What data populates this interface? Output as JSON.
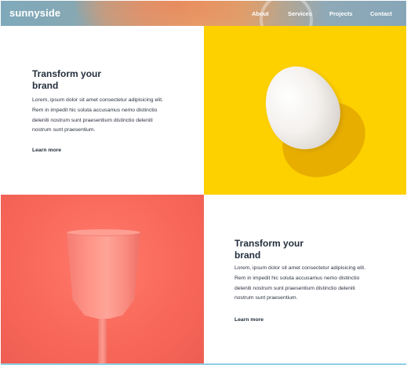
{
  "header": {
    "logo": "sunnyside",
    "nav": [
      {
        "label": "About"
      },
      {
        "label": "Services"
      },
      {
        "label": "Projects"
      },
      {
        "label": "Contact"
      }
    ]
  },
  "features": [
    {
      "heading_line1": "Transform your",
      "heading_line2": "brand",
      "body": "Lorem, ipsum dolor sit amet consectetur adipisicing elit. Rem in impedit hic soluta accusamus nemo distinctio deleniti nostrum sunt praesentium distinctio deleniti nostrum sunt praesentium.",
      "link": "Learn more",
      "image": "egg-image"
    },
    {
      "heading_line1": "Transform your",
      "heading_line2": "brand",
      "body": "Lorem, ipsum dolor sit amet consectetur adipisicing elit. Rem in impedit hic soluta accusamus nemo distinctio deleniti nostrum sunt praesentium distinctio deleniti nostrum sunt praesentium.",
      "link": "Learn more",
      "image": "cup-image"
    }
  ],
  "colors": {
    "egg_bg": "#fdd000",
    "cup_bg": "#f8685a",
    "heading": "#24303e"
  }
}
